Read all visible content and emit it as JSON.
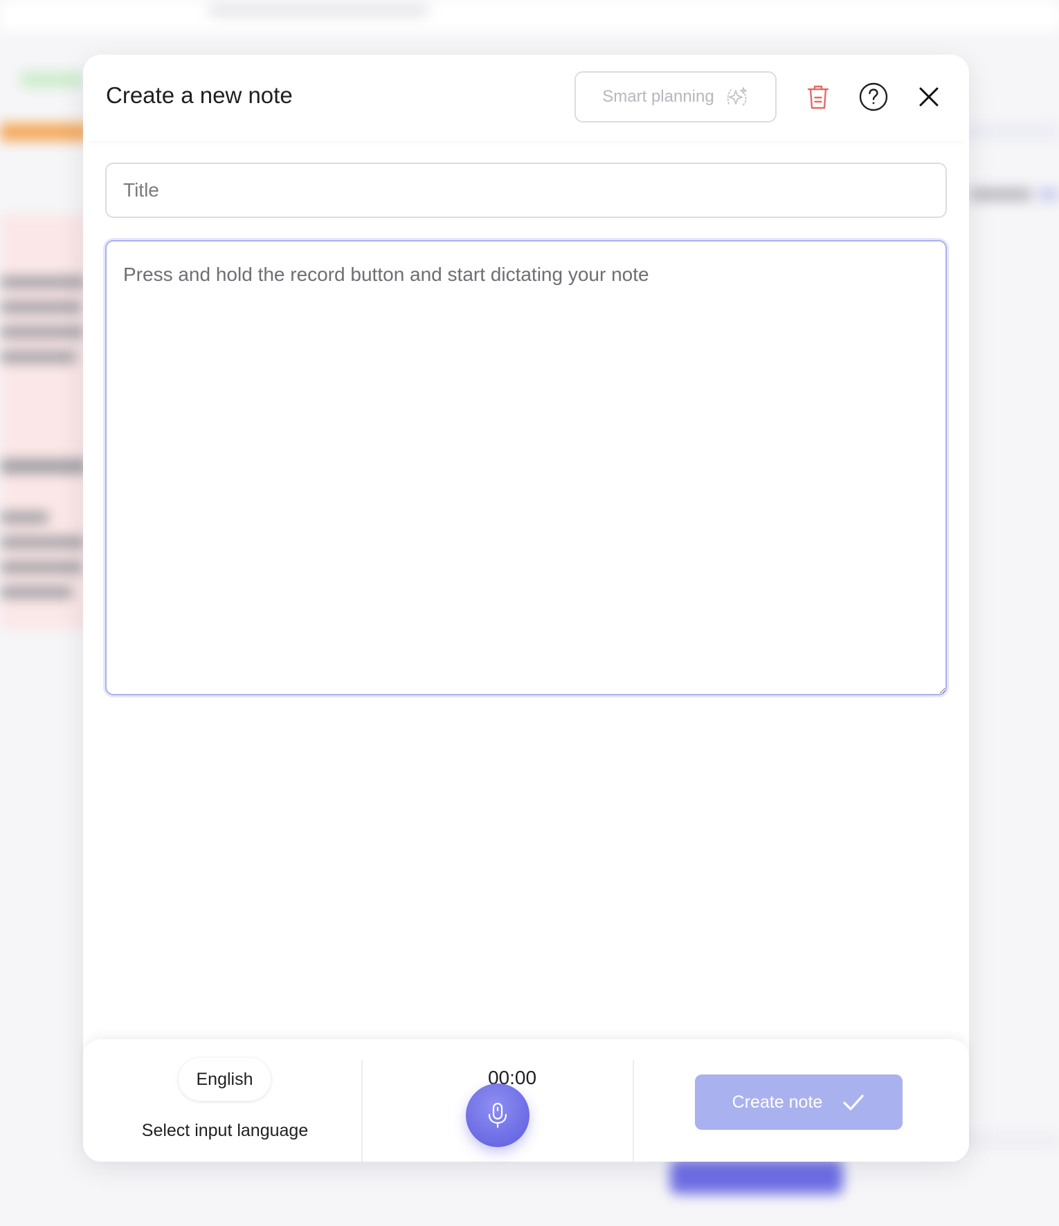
{
  "modal": {
    "title": "Create a new note",
    "smart_planning_label": "Smart planning",
    "icons": {
      "smart_planning": "sparkle-icon",
      "delete": "trash-icon",
      "help": "help-icon",
      "close": "close-icon",
      "record": "microphone-icon",
      "confirm": "check-icon"
    },
    "title_input": {
      "placeholder": "Title",
      "value": ""
    },
    "note_textarea": {
      "placeholder": "Press and hold the record button and start dictating your note",
      "value": ""
    }
  },
  "footer": {
    "language": "English",
    "language_caption": "Select input language",
    "timer": "00:00",
    "create_note_label": "Create note"
  },
  "colors": {
    "accent": "#6b6be4",
    "create_button_disabled": "#aab1ef",
    "delete_icon": "#e46a64",
    "focus_border": "#a9b0f2"
  }
}
